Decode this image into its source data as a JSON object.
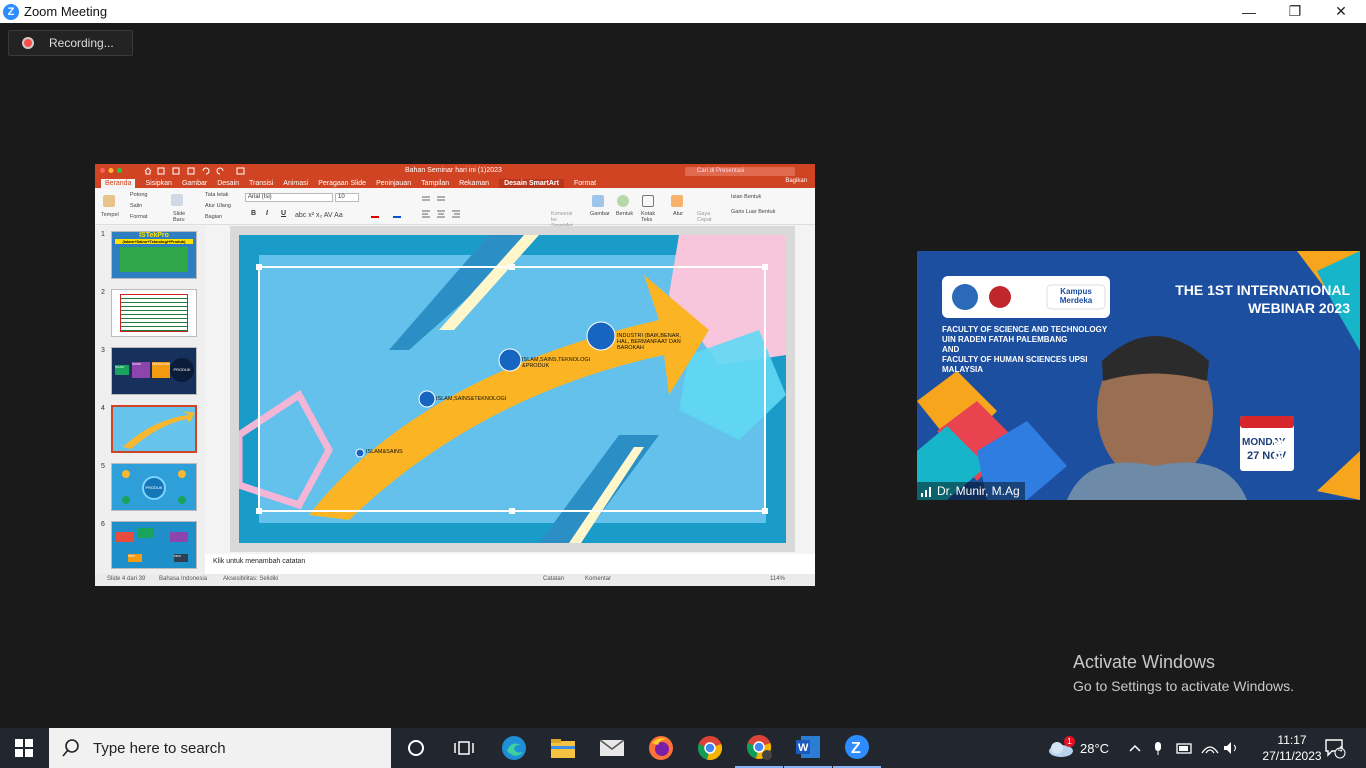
{
  "window": {
    "title": "Zoom Meeting",
    "minimize": "—",
    "maximize": "❐",
    "close": "✕"
  },
  "recording": {
    "label": "Recording..."
  },
  "ppt": {
    "doc_title": "Bahan Seminar hari ini (1)2023",
    "search_placeholder": "Cari di Presentasi",
    "tabs": [
      "Beranda",
      "Sisipkan",
      "Gambar",
      "Desain",
      "Transisi",
      "Animasi",
      "Peragaan Slide",
      "Peninjauan",
      "Tampilan",
      "Rekaman",
      "Desain SmartArt",
      "Format"
    ],
    "share": "Bagikan",
    "ribbon": {
      "paste": "Tempel",
      "cut": "Potong",
      "copy": "Salin",
      "format": "Format",
      "new_slide": "Slide Baru",
      "layout": "Tata letak",
      "reset": "Atur Ulang",
      "section": "Bagian",
      "font": "Arial (Isi)",
      "size": "10",
      "convert": "Konversi ke SmartArt",
      "picture": "Gambar",
      "shapes": "Bentuk",
      "textbox": "Kotak Teks",
      "arrange": "Atur",
      "quick_styles": "Gaya Cepat",
      "shape_fill": "Isian Bentuk",
      "shape_outline": "Garis Luar Bentuk",
      "bold": "B",
      "italic": "I",
      "underline": "U"
    },
    "thumbnails": [
      {
        "num": "1",
        "title": "ISTekPro",
        "sub": "(Islam+Sains+Teknologi+Produk)"
      },
      {
        "num": "2"
      },
      {
        "num": "3",
        "labels": [
          "ISLAM",
          "SAINS",
          "TEKNOLOGI",
          "PRODUK"
        ]
      },
      {
        "num": "4"
      },
      {
        "num": "5",
        "center": "PRODUK"
      },
      {
        "num": "6",
        "labels": [
          "MIPA",
          "MIPA"
        ]
      }
    ],
    "slide": {
      "points": [
        "ISLAM&SAINS",
        "ISLAM,SAINS&TEKNOLOGI",
        "ISLAM,SAINS,TEKNOLOGI &PRODUK",
        "INDUSTRI (BAIK,BENAR, HAL, BERMANFAAT DAN BAROKAH"
      ]
    },
    "notes": "Klik untuk menambah catatan",
    "status": {
      "slide": "Slide 4 dari 39",
      "language": "Bahasa Indonesia",
      "accessibility": "Aksesibilitas: Selidiki",
      "notes": "Catatan",
      "comments": "Komentar",
      "zoom": "114%"
    }
  },
  "video": {
    "participant": "Dr. Munir, M.Ag",
    "banner_title": "THE 1ST INTERNATIONAL WEBINAR 2023",
    "faculty_lines": [
      "FACULTY OF SCIENCE AND TECHNOLOGY",
      "UIN RADEN FATAH PALEMBANG",
      "AND",
      "FACULTY OF HUMAN SCIENCES UPSI",
      "MALAYSIA"
    ],
    "logo_kampus": "Kampus Merdeka",
    "date_day": "MONDAY",
    "date": "27 NOV",
    "year": "2023"
  },
  "watermark": {
    "line1": "Activate Windows",
    "line2": "Go to Settings to activate Windows."
  },
  "taskbar": {
    "search_placeholder": "Type here to search",
    "weather": "28°C",
    "weather_badge": "1",
    "time": "11:17",
    "date": "27/11/2023",
    "notifications": "4"
  },
  "colors": {
    "ppt_accent": "#d04423",
    "zoom_blue": "#2d8cff",
    "taskbar": "#22272f"
  }
}
